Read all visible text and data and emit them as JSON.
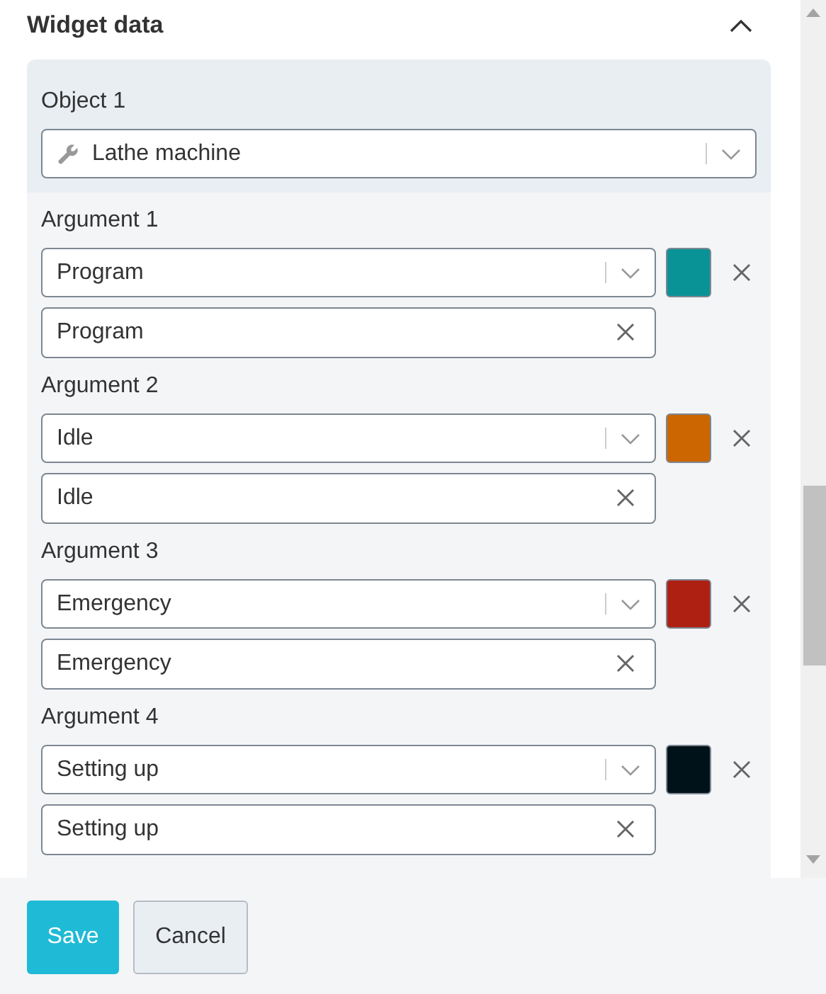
{
  "section": {
    "title": "Widget data",
    "expanded": true
  },
  "object": {
    "label": "Object 1",
    "value": "Lathe machine"
  },
  "arguments": [
    {
      "label": "Argument 1",
      "option": "Program",
      "color": "#0a9396",
      "text": "Program"
    },
    {
      "label": "Argument 2",
      "option": "Idle",
      "color": "#cc6600",
      "text": "Idle"
    },
    {
      "label": "Argument 3",
      "option": "Emergency",
      "color": "#ae2012",
      "text": "Emergency"
    },
    {
      "label": "Argument 4",
      "option": "Setting up",
      "color": "#001219",
      "text": "Setting up"
    }
  ],
  "buttons": [
    {
      "label": "Save",
      "kind": "primary"
    },
    {
      "label": "Cancel",
      "kind": "secondary"
    }
  ]
}
